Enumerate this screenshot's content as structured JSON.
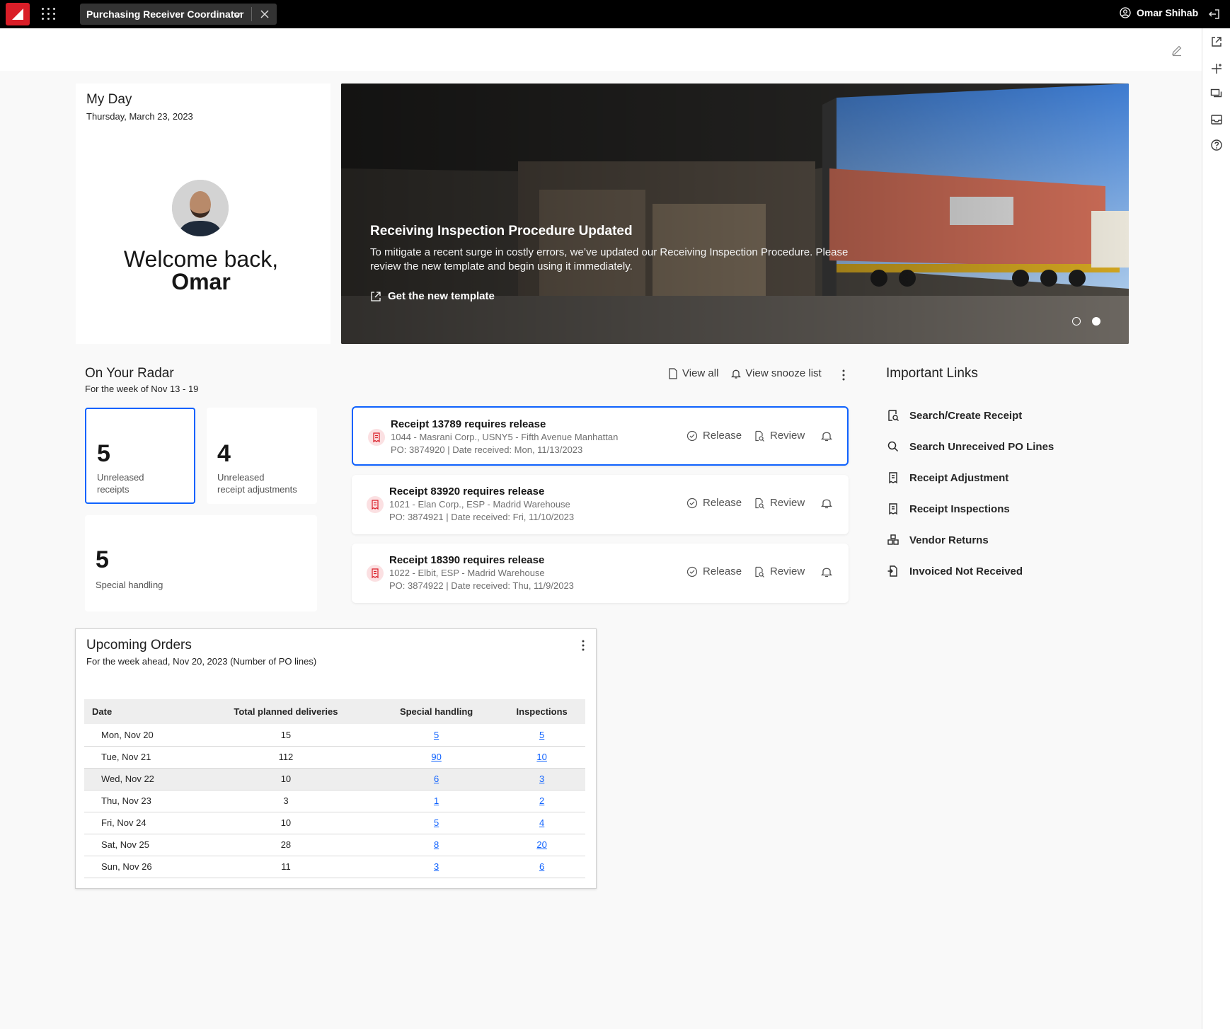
{
  "topbar": {
    "role": "Purchasing Receiver Coordinator",
    "user": "Omar Shihab"
  },
  "my_day": {
    "title": "My Day",
    "date": "Thursday, March 23, 2023",
    "welcome": "Welcome back,",
    "name": "Omar"
  },
  "hero": {
    "title": "Receiving Inspection Procedure Updated",
    "text": "To mitigate a recent surge in costly errors, we’ve updated our Receiving Inspection Procedure. Please review the new template and begin using it immediately.",
    "link": "Get the new template",
    "slides": 2,
    "active_slide": 2
  },
  "radar": {
    "title": "On Your Radar",
    "subtitle": "For the week of Nov 13 - 19",
    "view_all": "View all",
    "view_snooze": "View snooze list",
    "tiles": [
      {
        "count": "5",
        "label_line1": "Unreleased",
        "label_line2": "receipts"
      },
      {
        "count": "4",
        "label_line1": "Unreleased",
        "label_line2": "receipt adjustments"
      },
      {
        "count": "5",
        "label_line1": "Special handling",
        "label_line2": ""
      }
    ],
    "receipts": [
      {
        "title": "Receipt 13789 requires release",
        "line1": "1044 - Masrani Corp., USNY5 - Fifth Avenue Manhattan",
        "line2": "PO: 3874920 | Date received: Mon, 11/13/2023"
      },
      {
        "title": "Receipt 83920 requires release",
        "line1": "1021 - Elan Corp., ESP - Madrid Warehouse",
        "line2": "PO: 3874921 | Date received: Fri, 11/10/2023"
      },
      {
        "title": "Receipt 18390 requires release",
        "line1": "1022 - Elbit,  ESP - Madrid Warehouse",
        "line2": "PO: 3874922 | Date received: Thu, 11/9/2023"
      }
    ],
    "release_label": "Release",
    "review_label": "Review"
  },
  "links": {
    "title": "Important Links",
    "items": [
      {
        "label": "Search/Create Receipt",
        "icon": "receipt-search-icon"
      },
      {
        "label": "Search Unreceived PO Lines",
        "icon": "search-icon"
      },
      {
        "label": "Receipt Adjustment",
        "icon": "document-icon"
      },
      {
        "label": "Receipt Inspections",
        "icon": "document-icon"
      },
      {
        "label": "Vendor Returns",
        "icon": "boxes-icon"
      },
      {
        "label": "Invoiced Not Received",
        "icon": "invoice-icon"
      }
    ]
  },
  "orders": {
    "title": "Upcoming Orders",
    "subtitle": "For the week ahead, Nov 20, 2023 (Number of PO lines)",
    "columns": [
      "Date",
      "Total planned deliveries",
      "Special handling",
      "Inspections"
    ],
    "rows": [
      [
        "Mon, Nov 20",
        "15",
        "5",
        "5"
      ],
      [
        "Tue, Nov 21",
        "112",
        "90",
        "10"
      ],
      [
        "Wed, Nov 22",
        "10",
        "6",
        "3"
      ],
      [
        "Thu, Nov 23",
        "3",
        "1",
        "2"
      ],
      [
        "Fri, Nov 24",
        "10",
        "5",
        "4"
      ],
      [
        "Sat, Nov 25",
        "28",
        "8",
        "20"
      ],
      [
        "Sun, Nov 26",
        "11",
        "3",
        "6"
      ]
    ],
    "highlighted_row": 2
  },
  "colors": {
    "brand": "#da1e28",
    "accent": "#0f62fe",
    "topbar": "#000000"
  }
}
